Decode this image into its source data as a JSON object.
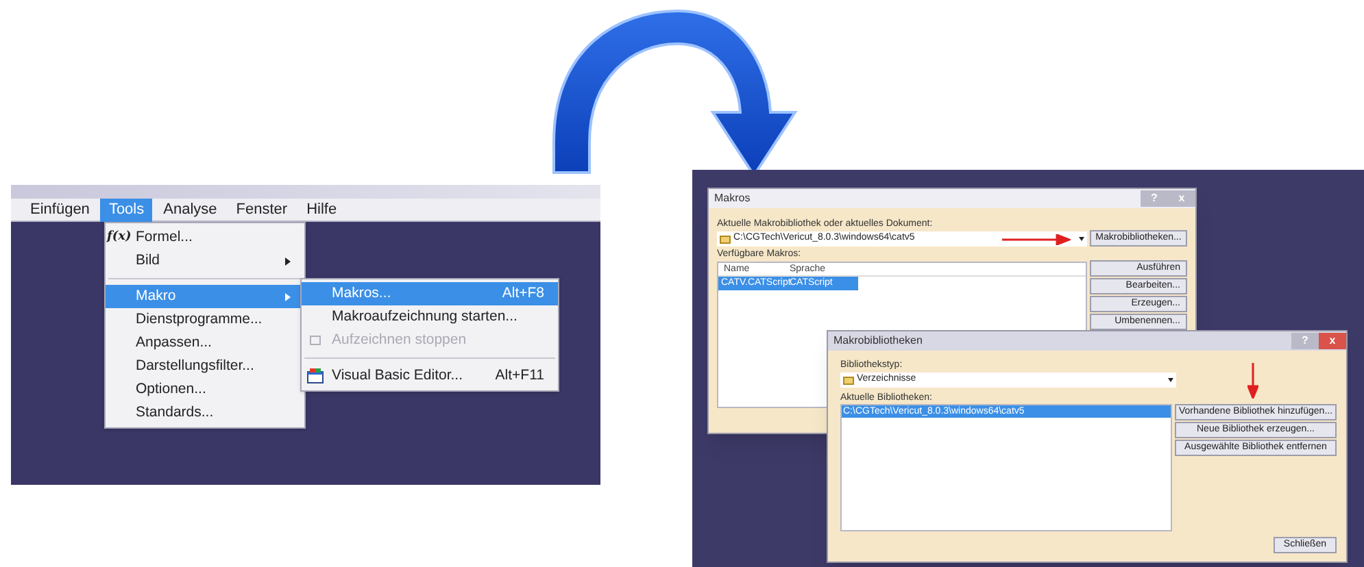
{
  "menu_screenshot": {
    "menubar": [
      {
        "label": "Einfügen",
        "selected": false
      },
      {
        "label": "Tools",
        "selected": true
      },
      {
        "label": "Analyse",
        "selected": false
      },
      {
        "label": "Fenster",
        "selected": false
      },
      {
        "label": "Hilfe",
        "selected": false
      }
    ],
    "tools_menu": [
      {
        "kind": "item",
        "icon_text": "f(x)",
        "label": "Formel...",
        "has_submenu": false,
        "selected": false
      },
      {
        "kind": "item",
        "label": "Bild",
        "has_submenu": true,
        "selected": false
      },
      {
        "kind": "separator"
      },
      {
        "kind": "item",
        "label": "Makro",
        "has_submenu": true,
        "selected": true
      },
      {
        "kind": "item",
        "label": "Dienstprogramme...",
        "has_submenu": false,
        "selected": false
      },
      {
        "kind": "item",
        "label": "Anpassen...",
        "has_submenu": false,
        "selected": false
      },
      {
        "kind": "item",
        "label": "Darstellungsfilter...",
        "has_submenu": false,
        "selected": false
      },
      {
        "kind": "item",
        "label": "Optionen...",
        "has_submenu": false,
        "selected": false
      },
      {
        "kind": "item",
        "label": "Standards...",
        "has_submenu": false,
        "selected": false
      }
    ],
    "makro_submenu": [
      {
        "kind": "item",
        "label": "Makros...",
        "shortcut": "Alt+F8",
        "selected": true,
        "disabled": false
      },
      {
        "kind": "item",
        "label": "Makroaufzeichnung starten...",
        "selected": false,
        "disabled": false
      },
      {
        "kind": "check_item",
        "label": "Aufzeichnen stoppen",
        "selected": false,
        "disabled": true
      },
      {
        "kind": "separator"
      },
      {
        "kind": "editor_item",
        "label": "Visual Basic Editor...",
        "shortcut": "Alt+F11",
        "selected": false,
        "disabled": false
      }
    ]
  },
  "makros_dialog": {
    "title": "Makros",
    "title_buttons": [
      "?",
      "x"
    ],
    "library_label": "Aktuelle Makrobibliothek oder aktuelles Dokument:",
    "library_value": "C:\\CGTech\\Vericut_8.0.3\\windows64\\catv5",
    "library_button": "Makrobibliotheken...",
    "macros_label": "Verfügbare Makros:",
    "columns": [
      "Name",
      "Sprache"
    ],
    "rows": [
      {
        "cells": [
          "CATV.CATScript",
          "CATScript"
        ],
        "selected": true
      }
    ],
    "buttons": [
      "Ausführen",
      "Bearbeiten...",
      "Erzeugen...",
      "Umbenennen..."
    ]
  },
  "bibliotheken_dialog": {
    "title": "Makrobibliotheken",
    "title_buttons": [
      "?",
      "x"
    ],
    "type_label": "Bibliothekstyp:",
    "type_value": "Verzeichnisse",
    "libraries_label": "Aktuelle Bibliotheken:",
    "libraries": [
      {
        "label": "C:\\CGTech\\Vericut_8.0.3\\windows64\\catv5",
        "selected": true
      }
    ],
    "buttons": [
      "Vorhandene Bibliothek hinzufügen...",
      "Neue Bibliothek erzeugen...",
      "Ausgewählte Bibliothek entfernen"
    ],
    "close_button": "Schließen"
  }
}
